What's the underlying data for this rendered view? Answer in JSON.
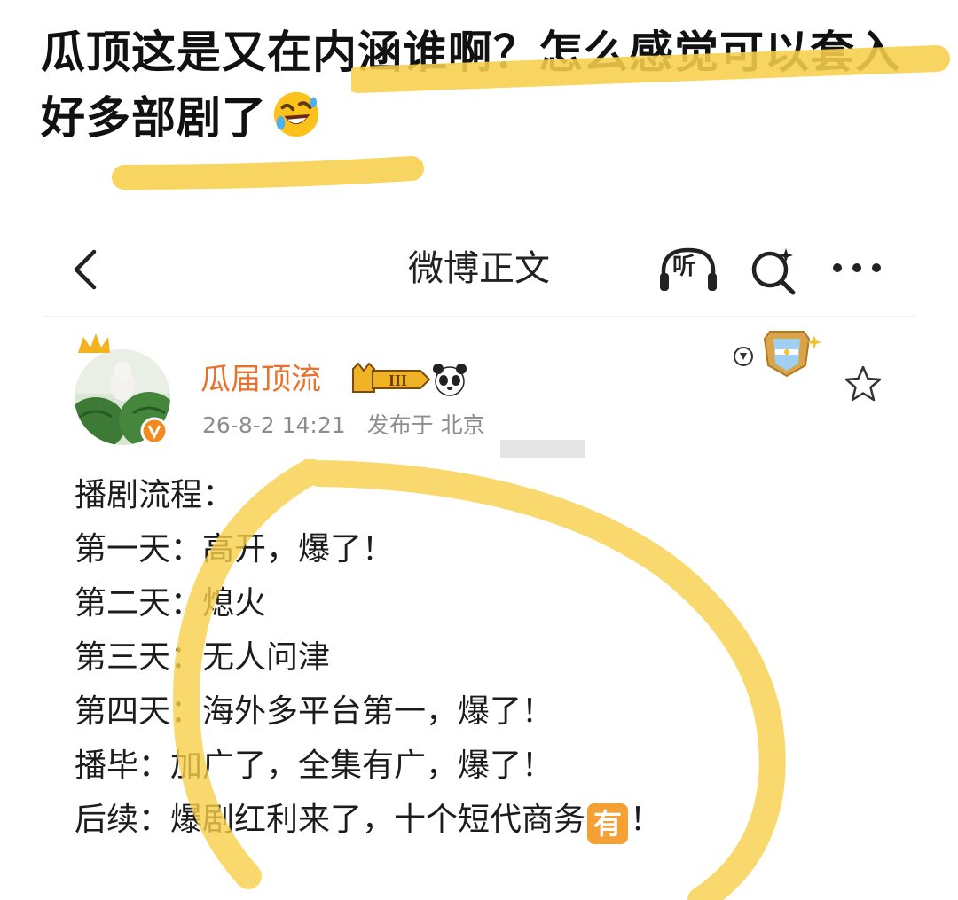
{
  "caption": {
    "text": "瓜顶这是又在内涵谁啊？怎么感觉可以套入好多部剧了",
    "emoji_icon": "rolling-on-floor-laughing-icon"
  },
  "nav": {
    "title": "微博正文",
    "listen_label": "听"
  },
  "post": {
    "username": "瓜届顶流",
    "vip_level": "III",
    "timestamp": "26-8-2 14:21",
    "location": "发布于 北京",
    "lines": [
      "播剧流程：",
      "第一天：高开，爆了！",
      "第二天：熄火",
      "第三天：无人问津",
      "第四天：海外多平台第一，爆了！",
      "播毕：加广了，全集有广，爆了！"
    ],
    "last_line_before": "后续：爆剧红利来了，十个短代商务",
    "last_line_badge": "有",
    "last_line_after": "！"
  },
  "colors": {
    "highlight": "#f7cf4a",
    "username": "#e8722b",
    "badge_orange": "#f5a034",
    "meta_gray": "#8d8d8d"
  }
}
